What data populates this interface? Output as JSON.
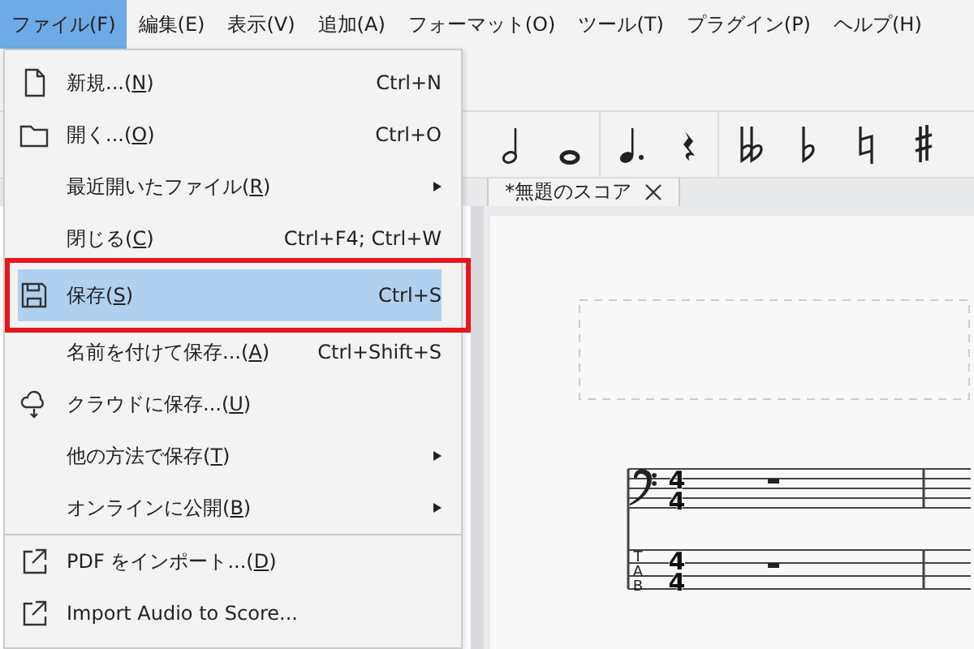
{
  "menubar": [
    {
      "label": "ファイル(F)",
      "selected": true
    },
    {
      "label": "編集(E)",
      "selected": false
    },
    {
      "label": "表示(V)",
      "selected": false
    },
    {
      "label": "追加(A)",
      "selected": false
    },
    {
      "label": "フォーマット(O)",
      "selected": false
    },
    {
      "label": "ツール(T)",
      "selected": false
    },
    {
      "label": "プラグイン(P)",
      "selected": false
    },
    {
      "label": "ヘルプ(H)",
      "selected": false
    }
  ],
  "file_menu": [
    {
      "kind": "document",
      "label": "新規...(N)",
      "shortcut": "Ctrl+N",
      "submenu": false,
      "selected": false
    },
    {
      "kind": "folder",
      "label": "開く...(O)",
      "shortcut": "Ctrl+O",
      "submenu": false,
      "selected": false
    },
    {
      "kind": "text",
      "label": "最近開いたファイル(R)",
      "submenu": true,
      "selected": false
    },
    {
      "kind": "text",
      "label": "閉じる(C)",
      "shortcut": "Ctrl+F4; Ctrl+W",
      "submenu": false,
      "selected": false
    },
    {
      "kind": "save",
      "label": "保存(S)",
      "shortcut": "Ctrl+S",
      "submenu": false,
      "selected": true,
      "outlined": true
    },
    {
      "kind": "text",
      "label": "名前を付けて保存...(A)",
      "shortcut": "Ctrl+Shift+S",
      "submenu": false,
      "selected": false
    },
    {
      "kind": "cloud",
      "label": "クラウドに保存...(U)",
      "submenu": false,
      "selected": false
    },
    {
      "kind": "text",
      "label": "他の方法で保存(T)",
      "submenu": true,
      "selected": false
    },
    {
      "kind": "text",
      "label": "オンラインに公開(B)",
      "submenu": true,
      "selected": false
    },
    {
      "kind": "separator"
    },
    {
      "kind": "export",
      "label": "PDF をインポート...(D)",
      "submenu": false,
      "selected": false
    },
    {
      "kind": "export",
      "label": "Import Audio to Score...",
      "submenu": false,
      "selected": false
    }
  ],
  "tabs": [
    {
      "label": "*無題のスコア",
      "selected": true
    }
  ],
  "score": {
    "staves": [
      {
        "kind": "bass",
        "time": [
          "4",
          "4"
        ]
      },
      {
        "kind": "tab",
        "clef": "TAB",
        "time": [
          "4",
          "4"
        ]
      }
    ]
  }
}
